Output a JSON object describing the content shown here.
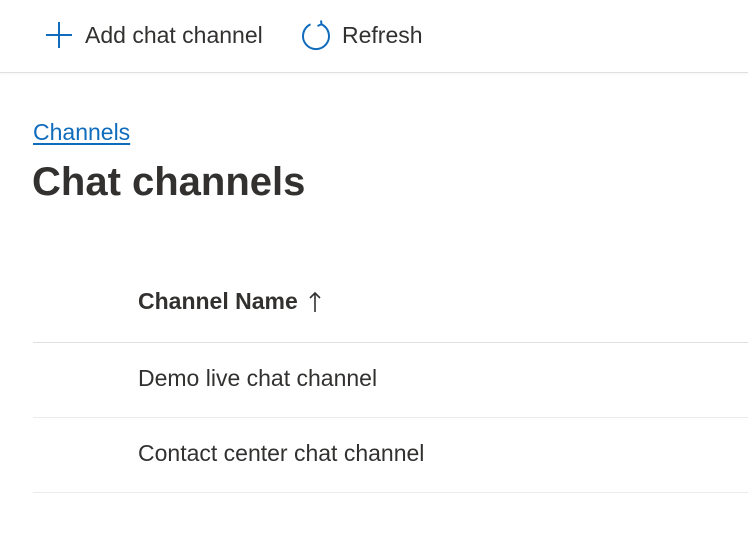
{
  "commandbar": {
    "add_label": "Add chat channel",
    "add_icon": "plus-icon",
    "refresh_label": "Refresh",
    "refresh_icon": "refresh-icon"
  },
  "breadcrumb": {
    "label": "Channels"
  },
  "page": {
    "title": "Chat channels"
  },
  "grid": {
    "columns": [
      {
        "label": "Channel Name",
        "sort": "ascending",
        "sort_icon": "arrow-up-icon"
      }
    ],
    "rows": [
      {
        "name": "Demo live chat channel"
      },
      {
        "name": "Contact center chat channel"
      }
    ]
  },
  "colors": {
    "accent": "#0f6cbd",
    "text": "#323130",
    "divider": "#e1dfdd"
  }
}
